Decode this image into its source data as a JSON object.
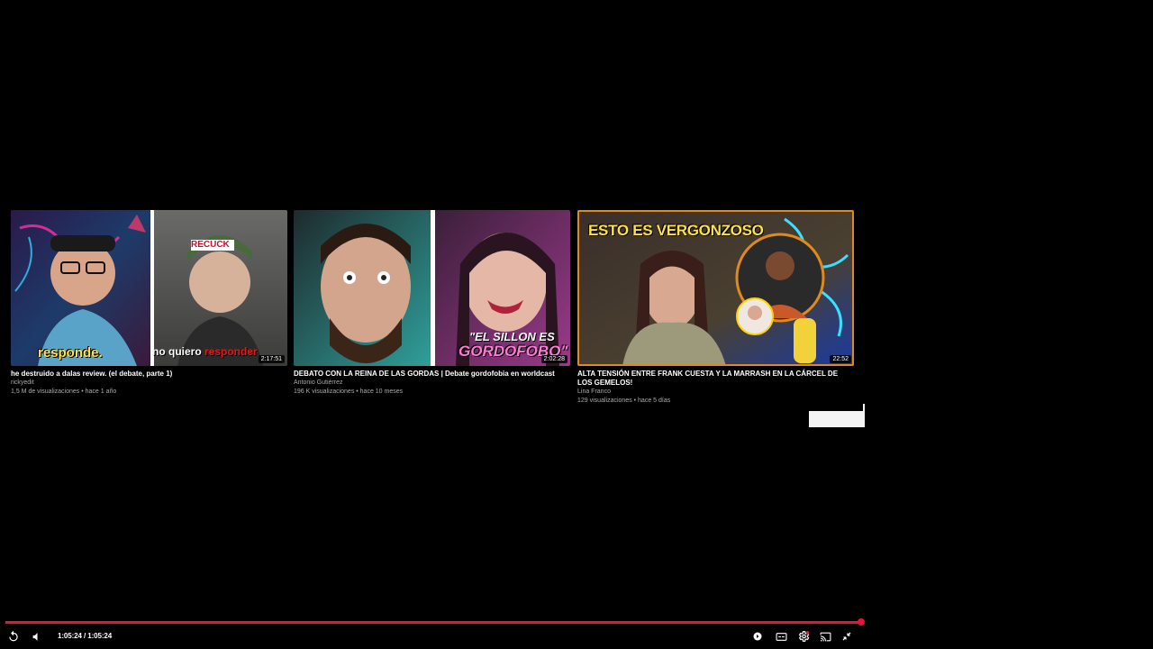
{
  "endscreen": {
    "cards": [
      {
        "title": "he destruido a dalas review. (el debate, parte 1)",
        "channel": "rickyedit",
        "meta": "1,5 M de visualizaciones • hace 1 año",
        "duration": "2:17:51",
        "thumb_text_left": "responde.",
        "thumb_text_right_white": "no quiero ",
        "thumb_text_right_red": "responder",
        "thumb_cap": "RECUCK"
      },
      {
        "title": "DEBATO CON LA REINA DE LAS GORDAS | Debate gordofobia en worldcast",
        "channel": "Antonio Gutiérrez",
        "meta": "196 K visualizaciones • hace 10 meses",
        "duration": "2:02:28",
        "thumb_text_line1": "\"EL SILLON ES",
        "thumb_text_line2": "GORDOFOBO\""
      },
      {
        "title": "ALTA TENSIÓN ENTRE FRANK CUESTA Y LA MARRASH EN LA CÁRCEL DE LOS GEMELOS!",
        "channel": "Lina Franco",
        "meta": "129 visualizaciones • hace 5 días",
        "duration": "22:52",
        "thumb_text": "ESTO ES VERGONZOSO"
      }
    ]
  },
  "player": {
    "time_display": "1:05:24 / 1:05:24",
    "progress_fraction": 1.0,
    "icons": {
      "replay": "replay-icon",
      "volume": "volume-icon",
      "autoplay": "autoplay-toggle-icon",
      "subtitles": "subtitles-icon",
      "settings": "settings-gear-icon",
      "cast": "cast-icon",
      "exit_fullscreen": "exit-fullscreen-icon"
    },
    "colors": {
      "progress": "#e8123d",
      "highlight_border": "#e08a1e"
    }
  }
}
